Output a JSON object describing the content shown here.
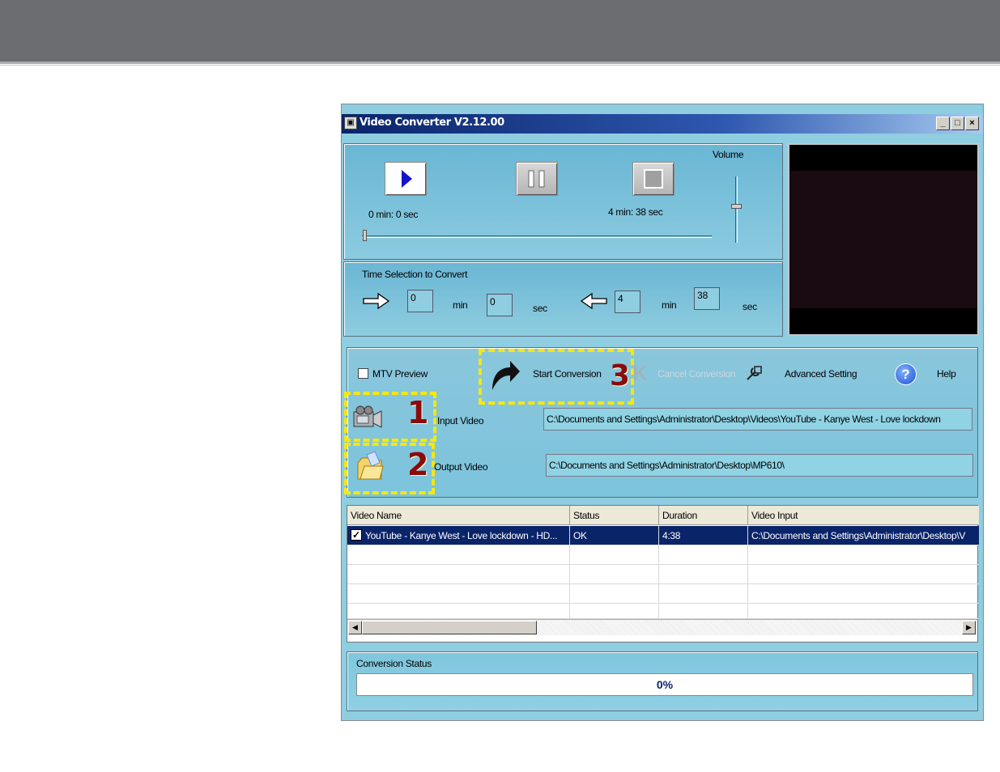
{
  "window": {
    "title": "Video Converter V2.12.00",
    "min_glyph": "_",
    "max_glyph": "□",
    "close_glyph": "×"
  },
  "player": {
    "volume_label": "Volume",
    "current_time": "0 min: 0 sec",
    "total_time": "4 min: 38 sec",
    "seek_position": 0,
    "volume_level": 0.6
  },
  "time_selection": {
    "label": "Time Selection to Convert",
    "start_min": "0",
    "start_sec": "0",
    "end_min": "4",
    "end_sec": "38",
    "min_label": "min",
    "sec_label": "sec"
  },
  "actions": {
    "mtv_preview_label": "MTV Preview",
    "mtv_preview_checked": false,
    "start_conversion_label": "Start Conversion",
    "cancel_conversion_label": "Cancel Conversion",
    "advanced_setting_label": "Advanced Setting",
    "help_label": "Help",
    "input_video_label": "Input Video",
    "input_video_path": "C:\\Documents and Settings\\Administrator\\Desktop\\Videos\\YouTube - Kanye West - Love lockdown",
    "output_video_label": "Output Video",
    "output_video_path": "C:\\Documents and Settings\\Administrator\\Desktop\\MP610\\"
  },
  "annotations": {
    "num1": "1",
    "num2": "2",
    "num3": "3"
  },
  "table": {
    "columns": [
      "Video Name",
      "Status",
      "Duration",
      "Video Input"
    ],
    "rows": [
      {
        "checked": true,
        "name": "YouTube - Kanye West - Love lockdown - HD...",
        "status": "OK",
        "duration": "4:38",
        "input": "C:\\Documents and Settings\\Administrator\\Desktop\\V"
      }
    ]
  },
  "conversion_status": {
    "label": "Conversion Status",
    "progress": 0,
    "progress_text": "0%"
  },
  "colors": {
    "accent": "#0a246a",
    "highlight": "#f7e80a",
    "number": "#8b0a0a"
  }
}
